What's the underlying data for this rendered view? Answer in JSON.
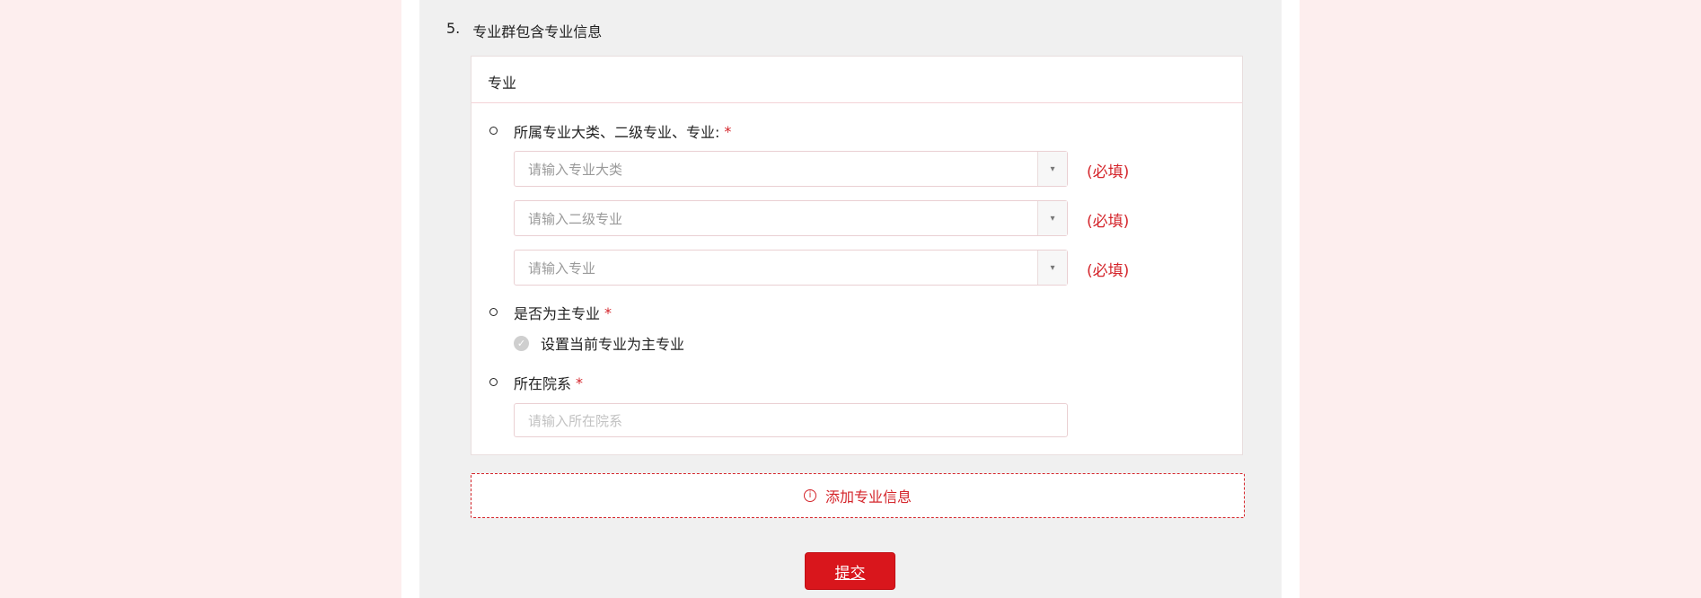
{
  "section": {
    "number": "5.",
    "title": "专业群包含专业信息"
  },
  "card": {
    "header": "专业",
    "major_field": {
      "label": "所属专业大类、二级专业、专业:",
      "required_mark": "*",
      "selects": [
        {
          "placeholder": "请输入专业大类",
          "must_text": "(必填)"
        },
        {
          "placeholder": "请输入二级专业",
          "must_text": "(必填)"
        },
        {
          "placeholder": "请输入专业",
          "must_text": "(必填)"
        }
      ],
      "arrow_glyph": "▾"
    },
    "main_major": {
      "label": "是否为主专业",
      "required_mark": "*",
      "checkbox_label": "设置当前专业为主专业",
      "checked": false
    },
    "department": {
      "label": "所在院系",
      "required_mark": "*",
      "placeholder": "请输入所在院系"
    }
  },
  "add_button": {
    "label": "添加专业信息",
    "icon": "info-circle-icon",
    "icon_glyph": "i"
  },
  "submit_button": {
    "label": "提交"
  },
  "colors": {
    "accent": "#d4242a",
    "page_bg": "#fdeeee",
    "panel_bg": "#f0f0f0",
    "submit_bg": "#d9161c"
  }
}
